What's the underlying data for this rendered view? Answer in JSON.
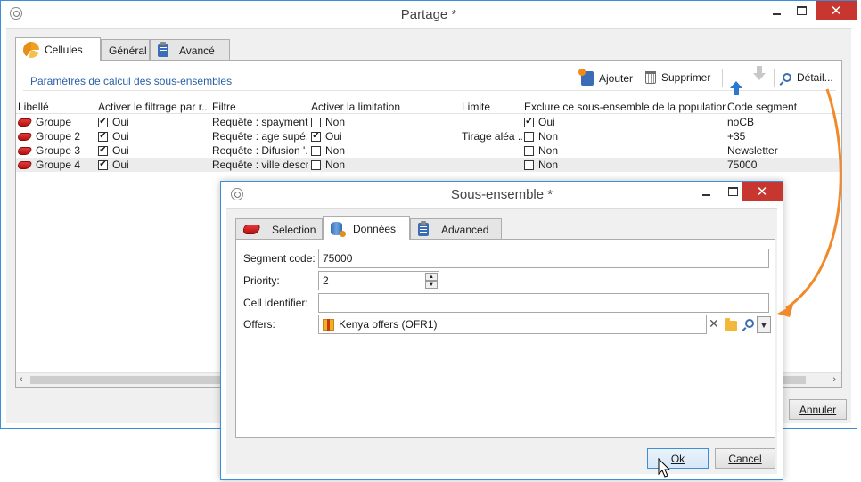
{
  "main_window": {
    "title": "Partage *",
    "tabs": [
      {
        "label": "Cellules",
        "icon": "cells-icon",
        "active": true
      },
      {
        "label": "Général",
        "active": false
      },
      {
        "label": "Avancé",
        "icon": "clipboard-icon",
        "active": false
      }
    ],
    "section_title": "Paramètres de calcul des sous-ensembles",
    "toolbar": {
      "add_label": "Ajouter",
      "delete_label": "Supprimer",
      "detail_label": "Détail..."
    },
    "table": {
      "columns": [
        "Libellé",
        "Activer le filtrage par r...",
        "Filtre",
        "Activer la limitation",
        "Limite",
        "Exclure ce sous-ensemble de la population",
        "Code segment"
      ],
      "rows": [
        {
          "label": "Groupe",
          "filter_on": "Oui",
          "filter": "Requête : spayment...",
          "limit_on": "Non",
          "limit": "",
          "exclude": "Oui",
          "code": "noCB"
        },
        {
          "label": "Groupe 2",
          "filter_on": "Oui",
          "filter": "Requête : age supé...",
          "limit_on": "Oui",
          "limit": "Tirage aléa ...",
          "exclude": "Non",
          "code": "+35"
        },
        {
          "label": "Groupe 3",
          "filter_on": "Oui",
          "filter": "Requête : Difusion '...",
          "limit_on": "Non",
          "limit": "",
          "exclude": "Non",
          "code": "Newsletter"
        },
        {
          "label": "Groupe 4",
          "filter_on": "Oui",
          "filter": "Requête : ville descr...",
          "limit_on": "Non",
          "limit": "",
          "exclude": "Non",
          "code": "75000"
        }
      ]
    },
    "cancel_label": "Annuler"
  },
  "dialog": {
    "title": "Sous-ensemble *",
    "tabs": [
      {
        "label": "Selection",
        "icon": "segment-icon",
        "active": false
      },
      {
        "label": "Données",
        "icon": "database-icon",
        "active": true
      },
      {
        "label": "Advanced",
        "icon": "clipboard-icon",
        "active": false
      }
    ],
    "fields": {
      "segment_code_label": "Segment code:",
      "segment_code_value": "75000",
      "priority_label": "Priority:",
      "priority_value": "2",
      "cell_identifier_label": "Cell identifier:",
      "cell_identifier_value": "",
      "offers_label": "Offers:",
      "offers_value": "Kenya offers (OFR1)"
    },
    "ok_label": "Ok",
    "cancel_label": "Cancel"
  },
  "colors": {
    "window_border": "#3c8fd6",
    "close_button": "#c7372f",
    "annotation_arrow": "#f08a2a",
    "section_title": "#2a5fa8"
  }
}
